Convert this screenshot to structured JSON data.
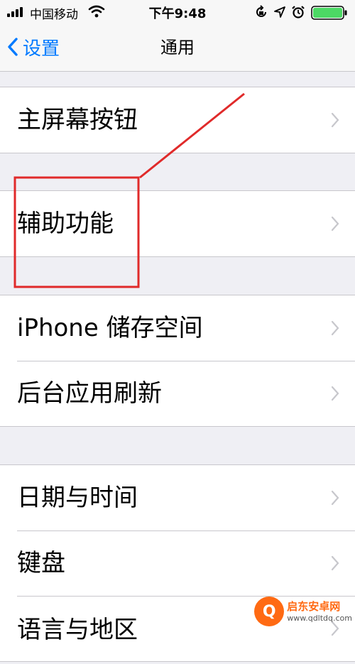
{
  "status_bar": {
    "carrier": "中国移动",
    "time": "下午9:48",
    "icons": [
      "signal-icon",
      "wifi-icon",
      "rotation-lock-icon",
      "location-icon",
      "alarm-icon",
      "battery-icon"
    ],
    "battery_level": 1.0
  },
  "nav": {
    "back_label": "设置",
    "title": "通用"
  },
  "groups": [
    {
      "items": [
        {
          "label": "主屏幕按钮"
        }
      ]
    },
    {
      "items": [
        {
          "label": "辅助功能"
        }
      ]
    },
    {
      "items": [
        {
          "label": "iPhone 储存空间"
        },
        {
          "label": "后台应用刷新"
        }
      ]
    },
    {
      "items": [
        {
          "label": "日期与时间"
        },
        {
          "label": "键盘"
        },
        {
          "label": "语言与地区"
        }
      ]
    }
  ],
  "annotation": {
    "color": "#e02a2a",
    "target": "辅助功能"
  },
  "watermark": {
    "name": "启东安卓网",
    "url": "www.qdltdq.com"
  },
  "colors": {
    "accent": "#007aff",
    "background": "#efeff4",
    "separator": "#c8c7cc"
  }
}
